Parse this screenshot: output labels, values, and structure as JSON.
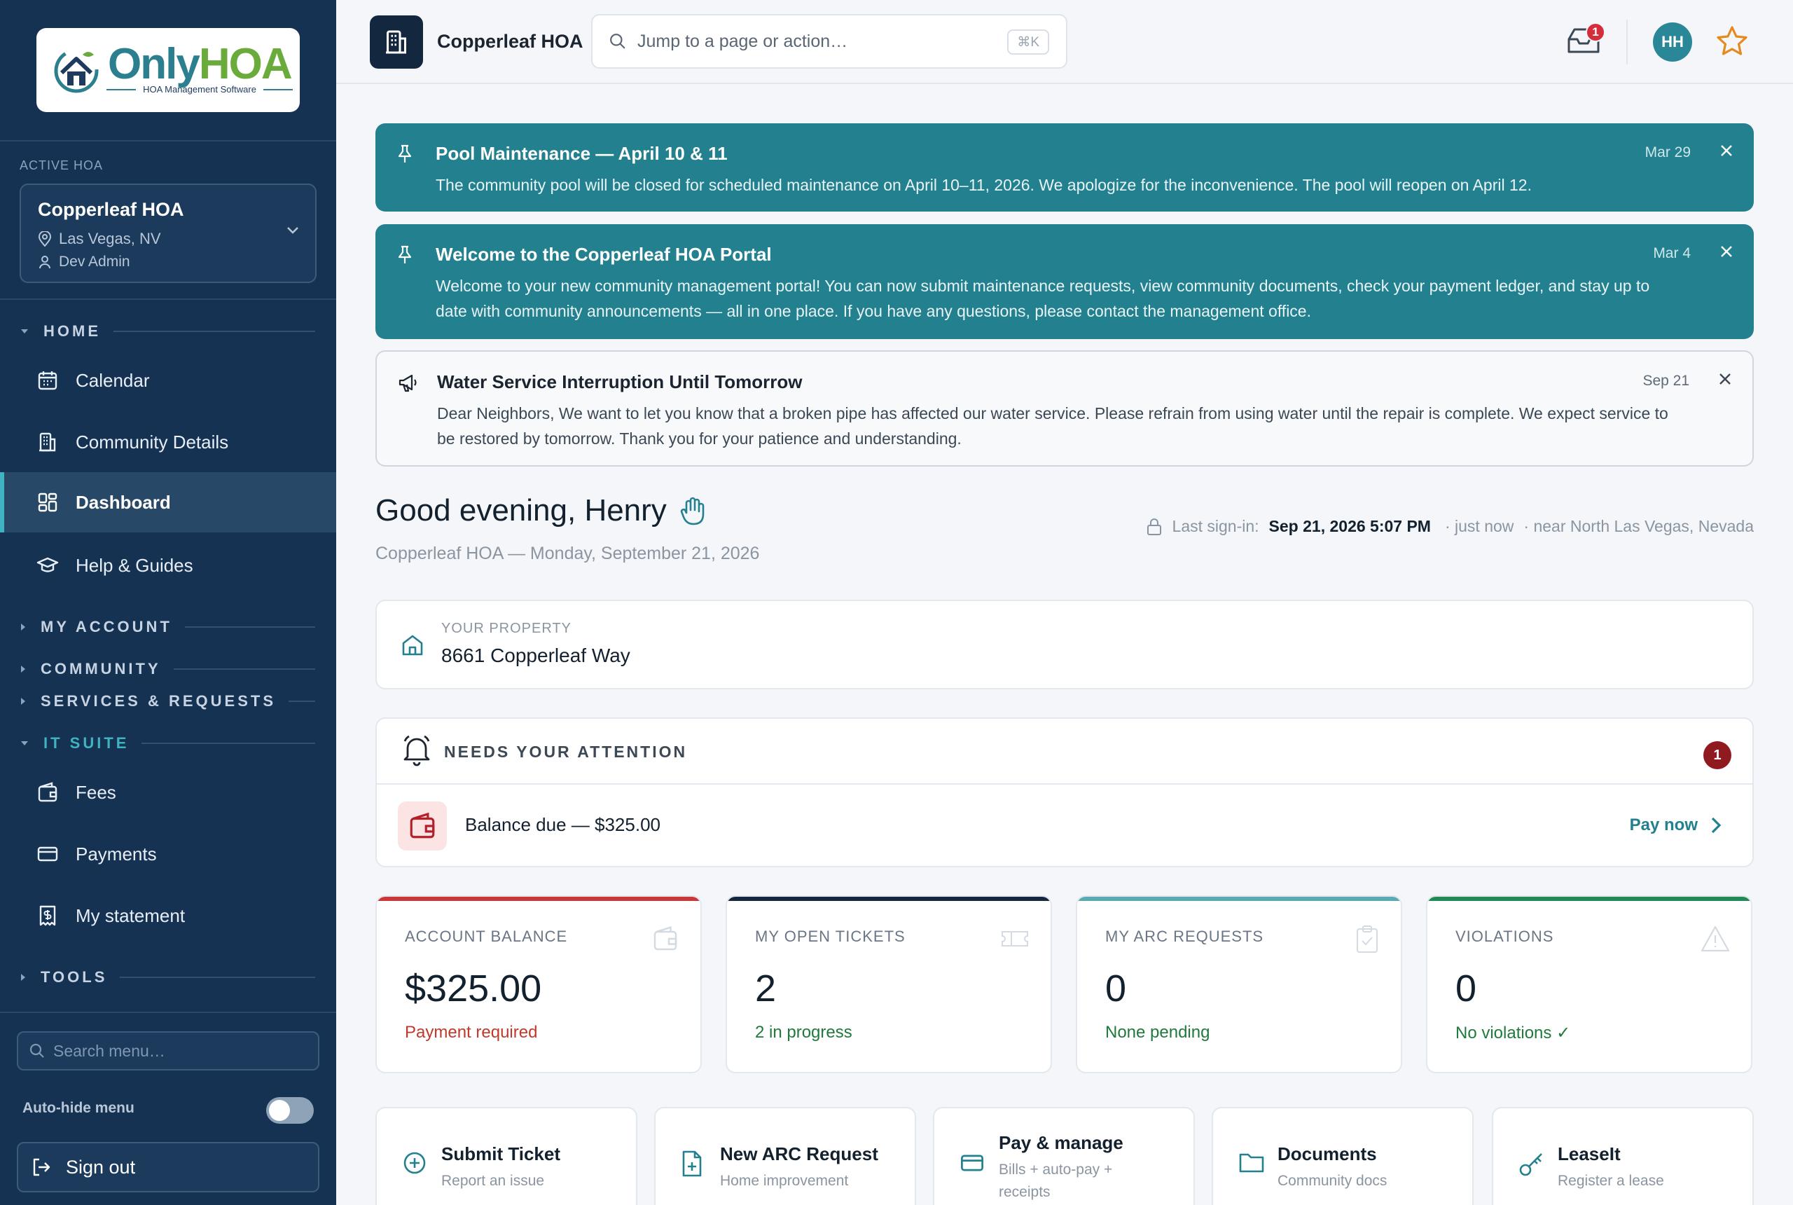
{
  "colors": {
    "sidebar_bg": "#163252",
    "accent_teal": "#23808f",
    "danger": "#c0392b",
    "success": "#1f7a3c"
  },
  "brand": {
    "logo_word_1": "Only",
    "logo_word_2": "HOA",
    "tagline": "HOA Management Software"
  },
  "sidebar": {
    "active_hoa_label": "ACTIVE HOA",
    "hoa": {
      "name": "Copperleaf HOA",
      "location": "Las Vegas, NV",
      "role": "Dev Admin"
    },
    "sections": {
      "home": "HOME",
      "my_account": "MY ACCOUNT",
      "community": "COMMUNITY",
      "services": "SERVICES & REQUESTS",
      "it_suite": "IT SUITE",
      "tools": "TOOLS"
    },
    "home_items": [
      {
        "label": "Calendar",
        "icon": "calendar-icon"
      },
      {
        "label": "Community Details",
        "icon": "building-icon"
      },
      {
        "label": "Dashboard",
        "icon": "dashboard-icon",
        "active": true
      },
      {
        "label": "Help & Guides",
        "icon": "graduation-cap-icon"
      }
    ],
    "it_suite_items": [
      {
        "label": "Fees",
        "icon": "wallet-icon"
      },
      {
        "label": "Payments",
        "icon": "credit-card-icon"
      },
      {
        "label": "My statement",
        "icon": "receipt-icon"
      }
    ],
    "search_placeholder": "Search menu…",
    "autohide_label": "Auto-hide menu",
    "autohide_on": false,
    "signout_label": "Sign out"
  },
  "topbar": {
    "hoa_name": "Copperleaf HOA",
    "search_placeholder": "Jump to a page or action…",
    "shortcut": "⌘K",
    "inbox_count": "1",
    "avatar_initials": "HH"
  },
  "announcements": [
    {
      "title": "Pool Maintenance — April 10 & 11",
      "body": "The community pool will be closed for scheduled maintenance on April 10–11, 2026. We apologize for the inconvenience. The pool will reopen on April 12.",
      "date": "Mar 29",
      "pinned": true
    },
    {
      "title": "Welcome to the Copperleaf HOA Portal",
      "body": "Welcome to your new community management portal! You can now submit maintenance requests, view community documents, check your payment ledger, and stay up to date with community announcements — all in one place. If you have any questions, please contact the management office.",
      "date": "Mar 4",
      "pinned": true
    },
    {
      "title": "Water Service Interruption Until Tomorrow",
      "body": "Dear Neighbors, We want to let you know that a broken pipe has affected our water service. Please refrain from using water until the repair is complete. We expect service to be restored by tomorrow. Thank you for your patience and understanding.",
      "date": "Sep 21",
      "pinned": false
    }
  ],
  "greeting": {
    "title": "Good evening, Henry",
    "subtitle": "Copperleaf HOA — Monday, September 21, 2026",
    "last_signin_label": "Last sign-in:",
    "last_signin_value": "Sep 21, 2026 5:07 PM",
    "last_signin_relative": "· just now",
    "last_signin_location": "· near North Las Vegas, Nevada"
  },
  "property": {
    "label": "YOUR PROPERTY",
    "address": "8661 Copperleaf Way"
  },
  "attention": {
    "title": "NEEDS YOUR ATTENTION",
    "count": "1",
    "item_text": "Balance due — $325.00",
    "action": "Pay now"
  },
  "stats": [
    {
      "label": "ACCOUNT BALANCE",
      "value": "$325.00",
      "sub": "Payment required",
      "sub_color": "#c0392b",
      "bar_color": "#c8373a",
      "icon": "wallet-icon"
    },
    {
      "label": "MY OPEN TICKETS",
      "value": "2",
      "sub": "2 in progress",
      "sub_color": "#1f7a3c",
      "bar_color": "#13273f",
      "icon": "ticket-icon"
    },
    {
      "label": "MY ARC REQUESTS",
      "value": "0",
      "sub": "None pending",
      "sub_color": "#1f7a3c",
      "bar_color": "#5aaab3",
      "icon": "clipboard-check-icon"
    },
    {
      "label": "VIOLATIONS",
      "value": "0",
      "sub": "No violations ✓",
      "sub_color": "#1f7a3c",
      "bar_color": "#1f8a55",
      "icon": "warning-icon"
    }
  ],
  "quick_actions": [
    {
      "title": "Submit Ticket",
      "sub": "Report an issue",
      "icon": "plus-circle-icon"
    },
    {
      "title": "New ARC Request",
      "sub": "Home improvement",
      "icon": "file-plus-icon"
    },
    {
      "title": "Pay & manage",
      "sub": "Bills + auto-pay + receipts",
      "icon": "credit-card-icon"
    },
    {
      "title": "Documents",
      "sub": "Community docs",
      "icon": "folder-icon"
    },
    {
      "title": "LeaseIt",
      "sub": "Register a lease",
      "icon": "key-icon"
    }
  ]
}
